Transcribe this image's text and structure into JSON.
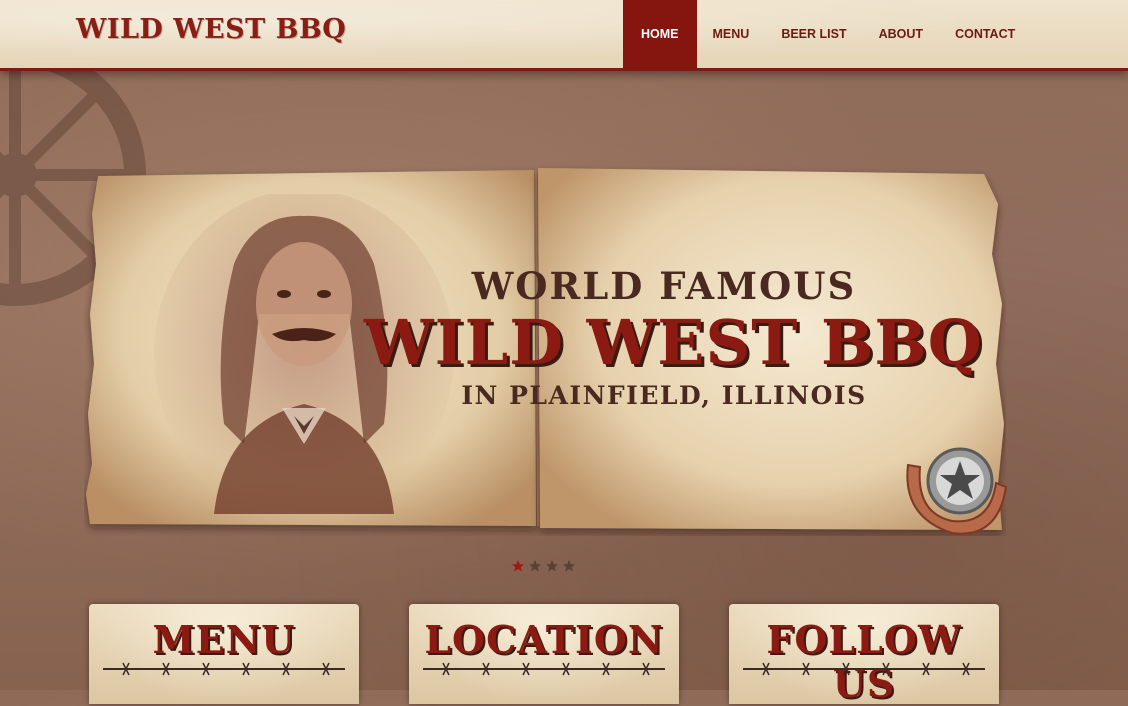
{
  "site": {
    "logo": "WILD WEST BBQ"
  },
  "nav": {
    "items": [
      {
        "label": "HOME",
        "active": true
      },
      {
        "label": "MENU",
        "active": false
      },
      {
        "label": "BEER LIST",
        "active": false
      },
      {
        "label": "ABOUT",
        "active": false
      },
      {
        "label": "CONTACT",
        "active": false
      }
    ]
  },
  "hero": {
    "line1": "WORLD FAMOUS",
    "line2": "WILD WEST BBQ",
    "line3": "IN PLAINFIELD, ILLINOIS"
  },
  "slider": {
    "slide_count": 4,
    "active_index": 0
  },
  "panels": [
    {
      "title": "MENU"
    },
    {
      "title": "LOCATION"
    },
    {
      "title": "FOLLOW US"
    }
  ],
  "colors": {
    "brand_red": "#85150f",
    "text_brown": "#4a2a20",
    "parchment": "#e8d7b8",
    "background": "#8e6a57"
  }
}
